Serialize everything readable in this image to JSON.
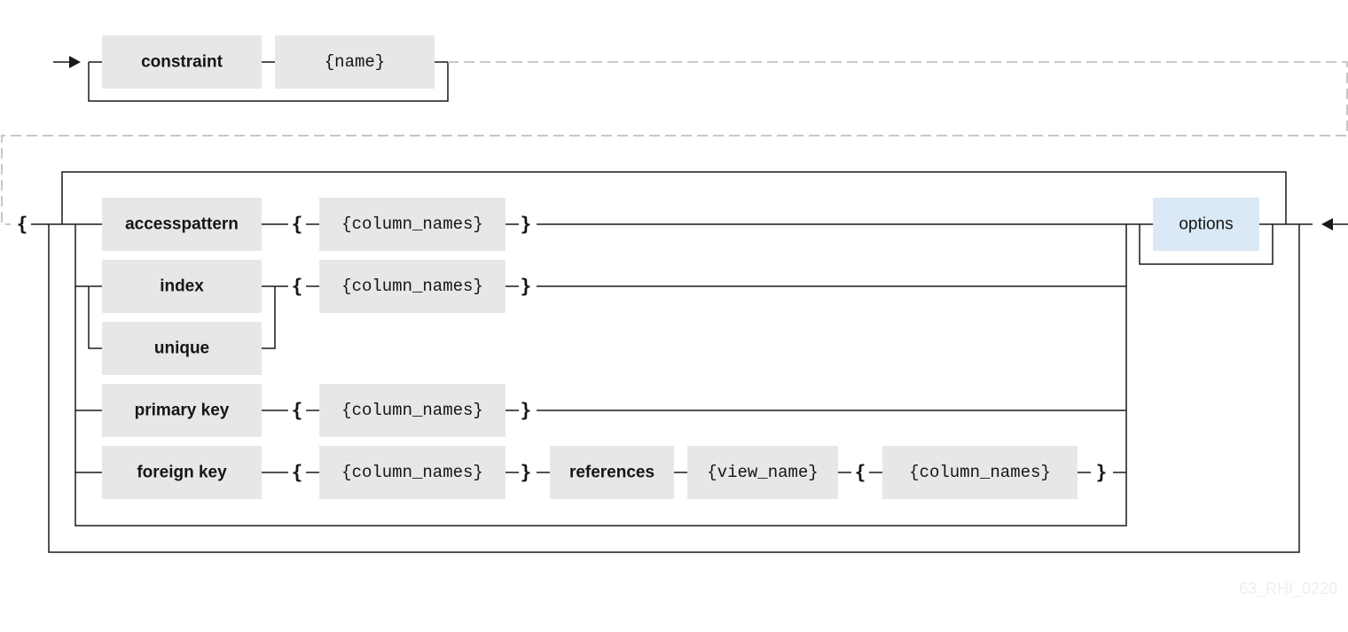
{
  "diagram": {
    "top_row": {
      "constraint": "constraint",
      "name": "{name}"
    },
    "open_brace": "{",
    "close_brace": "}",
    "rows": {
      "accesspattern": {
        "keyword": "accesspattern",
        "columns": "{column_names}"
      },
      "index": {
        "keyword": "index",
        "columns": "{column_names}"
      },
      "unique": {
        "keyword": "unique"
      },
      "primary_key": {
        "keyword": "primary key",
        "columns": "{column_names}"
      },
      "foreign_key": {
        "keyword": "foreign key",
        "columns": "{column_names}",
        "references": "references",
        "view_name": "{view_name}",
        "ref_columns": "{column_names}"
      }
    },
    "options": "options",
    "options_color": "#dbe8f6",
    "watermark": "63_RHI_0220"
  }
}
